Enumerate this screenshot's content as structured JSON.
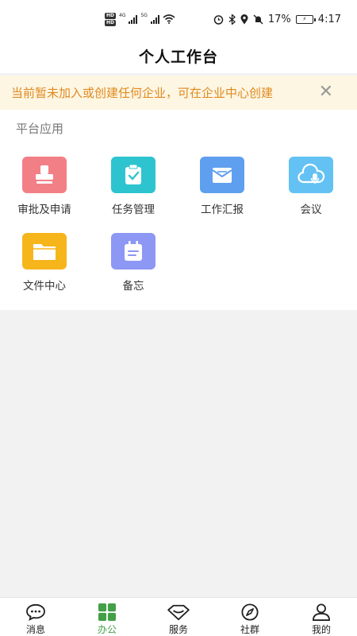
{
  "status_bar": {
    "hd1": "HD",
    "hd2": "HD",
    "net1": "4G",
    "net2": "5G",
    "battery": "17%",
    "time": "4:17",
    "icons": [
      "wifi-icon",
      "alarm-icon",
      "bluetooth-icon",
      "location-icon",
      "mute-icon",
      "battery-icon"
    ]
  },
  "header": {
    "title": "个人工作台"
  },
  "notice": {
    "text": "当前暂未加入或创建任何企业，可在企业中心创建",
    "close": "✕"
  },
  "section": {
    "title": "平台应用"
  },
  "apps": [
    {
      "label": "审批及申请",
      "icon": "stamp-icon",
      "color": "#f37f86"
    },
    {
      "label": "任务管理",
      "icon": "clipboard-check-icon",
      "color": "#2ec4cf"
    },
    {
      "label": "工作汇报",
      "icon": "mail-icon",
      "color": "#5f9ff0"
    },
    {
      "label": "会议",
      "icon": "cloud-mic-icon",
      "color": "#63c2f3"
    },
    {
      "label": "文件中心",
      "icon": "folder-icon",
      "color": "#f7b51c"
    },
    {
      "label": "备忘",
      "icon": "calendar-note-icon",
      "color": "#8d97f4"
    }
  ],
  "tabs": [
    {
      "label": "消息",
      "icon": "chat-bubble-icon"
    },
    {
      "label": "办公",
      "icon": "grid-icon",
      "active": true,
      "color": "#43a047"
    },
    {
      "label": "服务",
      "icon": "diamond-icon"
    },
    {
      "label": "社群",
      "icon": "compass-icon"
    },
    {
      "label": "我的",
      "icon": "user-icon"
    }
  ]
}
